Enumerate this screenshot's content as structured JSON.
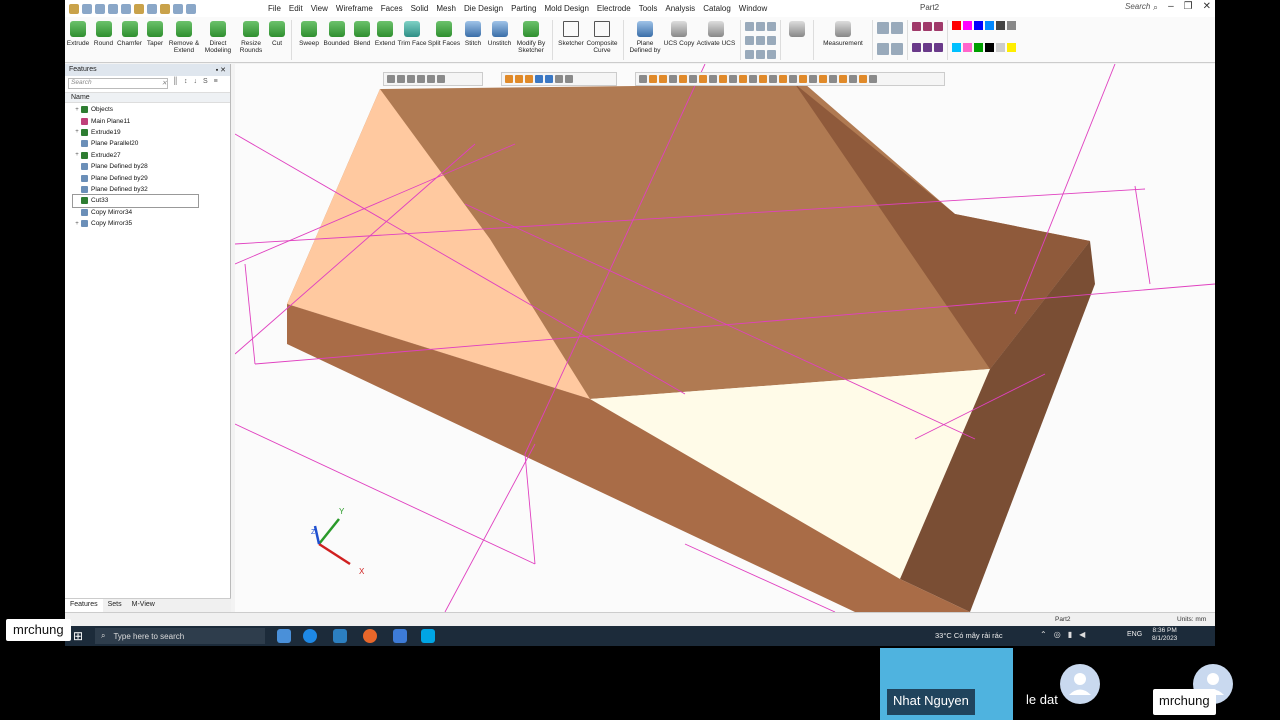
{
  "app": {
    "document_title": "Part2",
    "menu": [
      "File",
      "Edit",
      "View",
      "Wireframe",
      "Faces",
      "Solid",
      "Mesh",
      "Die Design",
      "Parting",
      "Mold Design",
      "Electrode",
      "Tools",
      "Analysis",
      "Catalog",
      "Window"
    ],
    "search_label": "Search"
  },
  "ribbon": {
    "extrude": "Extrude",
    "round": "Round",
    "chamfer": "Chamfer",
    "taper": "Taper",
    "remove_extend": "Remove & Extend",
    "direct_modeling": "Direct Modeling",
    "resize_rounds": "Resize Rounds",
    "cut": "Cut",
    "sweep": "Sweep",
    "bounded": "Bounded",
    "blend": "Blend",
    "extend": "Extend",
    "trim_face": "Trim Face",
    "split_faces": "Split Faces",
    "stitch": "Stitch",
    "unstitch": "Unstitch",
    "modify_by_sketcher": "Modify By Sketcher",
    "sketcher": "Sketcher",
    "composite_curve": "Composite Curve",
    "plane_defined_by": "Plane Defined by",
    "ucs_copy": "UCS Copy",
    "activate_ucs": "Activate UCS",
    "measurement": "Measurement"
  },
  "features_panel": {
    "title": "Features",
    "search_placeholder": "Search",
    "column_name": "Name",
    "items": [
      {
        "label": "Objects",
        "expander": "+"
      },
      {
        "label": "Main Plane11",
        "expander": ""
      },
      {
        "label": "Extrude19",
        "expander": "+"
      },
      {
        "label": "Plane Parallel20",
        "expander": ""
      },
      {
        "label": "Extrude27",
        "expander": "+"
      },
      {
        "label": "Plane Defined by28",
        "expander": ""
      },
      {
        "label": "Plane Defined by29",
        "expander": ""
      },
      {
        "label": "Plane Defined by32",
        "expander": ""
      },
      {
        "label": "Cut33",
        "expander": ""
      },
      {
        "label": "Copy Mirror34",
        "expander": ""
      },
      {
        "label": "Copy Mirror35",
        "expander": "+"
      }
    ],
    "tabs": [
      "Features",
      "Sets",
      "M-View"
    ]
  },
  "viewport": {
    "axis_x": "X",
    "axis_y": "Y",
    "axis_z": "Z"
  },
  "statusbar": {
    "doc": "Part2",
    "units": "Units: mm"
  },
  "taskbar": {
    "search_placeholder": "Type here to search",
    "weather": "33°C  Có mây rải rác",
    "language": "ENG",
    "time": "8:36 PM",
    "date": "8/1/2023"
  },
  "meeting": {
    "presenter_label": "mrchung",
    "participants": [
      {
        "name": "Nhat Nguyen"
      },
      {
        "name": "le dat"
      },
      {
        "name": "mrchung"
      }
    ]
  },
  "colors": {
    "solid_top": "#b07a52",
    "solid_side": "#9a6040",
    "solid_light": "#ffc9a0",
    "solid_cream": "#fffbe8",
    "plane_lines": "#e040c0",
    "presenter_tile": "#4fb3df"
  }
}
